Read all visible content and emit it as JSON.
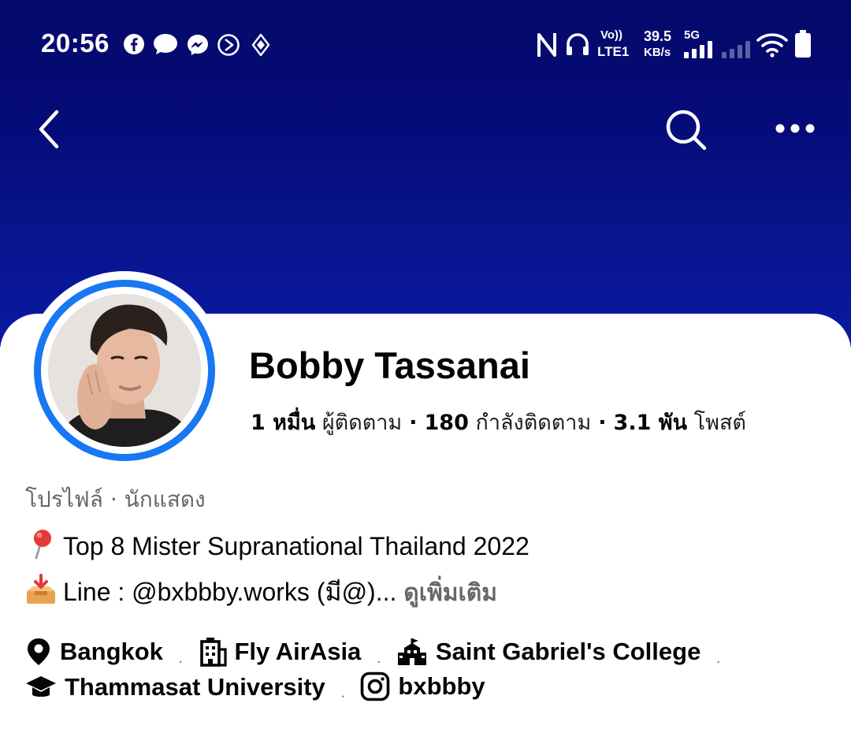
{
  "status_bar": {
    "time": "20:56",
    "volte_label": "Vo))",
    "lte_label": "LTE1",
    "speed_value": "39.5",
    "speed_unit": "KB/s",
    "network_type": "5G",
    "notification_icons": [
      "facebook-icon",
      "chat-bubble-icon",
      "messenger-icon",
      "media-play-icon",
      "diamond-icon"
    ],
    "system_icons": [
      "nfc-icon",
      "headset-icon",
      "signal-icon",
      "wifi-icon",
      "battery-icon"
    ]
  },
  "nav": {
    "back_icon": "chevron-left-icon",
    "search_icon": "search-icon",
    "more_icon": "more-horizontal-icon"
  },
  "profile": {
    "name": "Bobby Tassanai",
    "followers_value": "1 หมื่น",
    "followers_label": "ผู้ติดตาม",
    "following_value": "180",
    "following_label": "กำลังติดตาม",
    "posts_value": "3.1 พัน",
    "posts_label": "โพสต์",
    "stats_separator": "·",
    "category": "โปรไฟล์ · นักแสดง",
    "accent_color": "#1877f2"
  },
  "bio": {
    "line1_text": "Top 8 Mister Supranational Thailand 2022",
    "line1_icon": "round-pushpin-emoji",
    "line2_text": "Line : @bxbbby.works (มี@)...",
    "line2_icon": "inbox-tray-emoji",
    "see_more": "ดูเพิ่มเติม"
  },
  "details": {
    "location": "Bangkok",
    "work": "Fly AirAsia",
    "school": "Saint Gabriel's College",
    "university": "Thammasat University",
    "instagram": "bxbbby",
    "separator": "·"
  },
  "colors": {
    "cover_top": "#05096a",
    "cover_bottom": "#0a19a2",
    "text_primary": "#050505",
    "text_secondary": "#65676b"
  }
}
